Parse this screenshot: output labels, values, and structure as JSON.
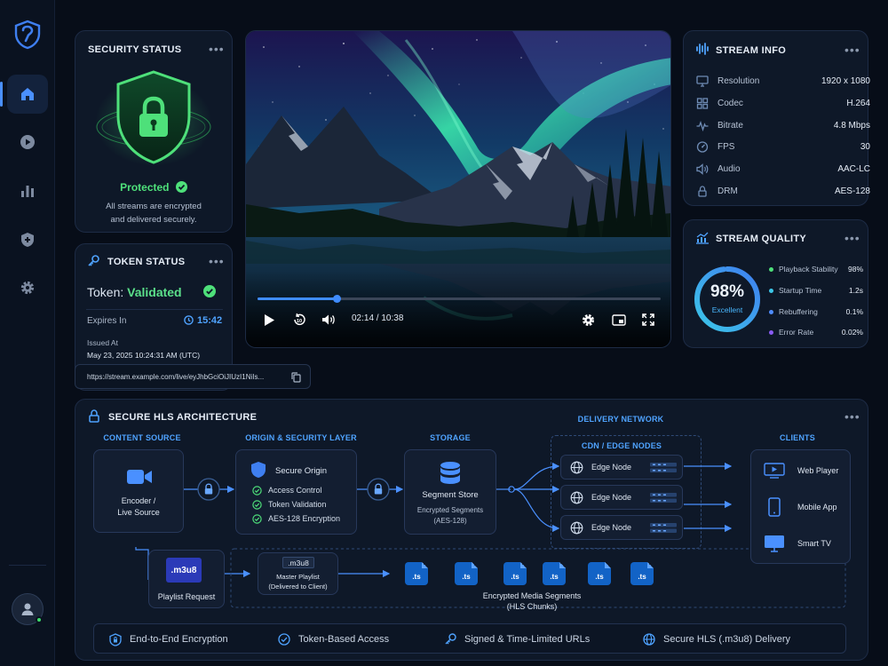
{
  "sidebar": {
    "items": [
      {
        "name": "home",
        "icon": "home-icon",
        "active": true
      },
      {
        "name": "streams",
        "icon": "play-icon",
        "active": false
      },
      {
        "name": "analytics",
        "icon": "bar-chart-icon",
        "active": false
      },
      {
        "name": "security",
        "icon": "shield-plus-icon",
        "active": false
      },
      {
        "name": "settings",
        "icon": "gear-icon",
        "active": false
      }
    ]
  },
  "security": {
    "title": "SECURITY STATUS",
    "status": "Protected",
    "description_line1": "All streams are encrypted",
    "description_line2": "and delivered securely."
  },
  "token": {
    "title": "TOKEN STATUS",
    "prefix": "Token:",
    "value": "Validated",
    "expires_label": "Expires In",
    "expires_value": "15:42",
    "issued_label": "Issued At",
    "issued_value": "May 23, 2025 10:24:31 AM (UTC)",
    "url": "https://stream.example.com/live/eyJhbGciOiJIUzI1NiIs..."
  },
  "player": {
    "current_time": "02:14",
    "duration": "10:38",
    "time_display": "02:14 / 10:38",
    "progress": 0.195
  },
  "stream_info": {
    "title": "STREAM INFO",
    "rows": [
      {
        "label": "Resolution",
        "value": "1920 x 1080",
        "icon": "monitor-icon"
      },
      {
        "label": "Codec",
        "value": "H.264",
        "icon": "grid-icon"
      },
      {
        "label": "Bitrate",
        "value": "4.8 Mbps",
        "icon": "pulse-icon"
      },
      {
        "label": "FPS",
        "value": "30",
        "icon": "speedometer-icon"
      },
      {
        "label": "Audio",
        "value": "AAC-LC",
        "icon": "speaker-icon"
      },
      {
        "label": "DRM",
        "value": "AES-128",
        "icon": "lock-icon"
      }
    ]
  },
  "quality": {
    "title": "STREAM QUALITY",
    "score": "98%",
    "score_value": 0.98,
    "score_label": "Excellent",
    "rows": [
      {
        "label": "Playback Stability",
        "value": "98%",
        "color": "#4ee07a"
      },
      {
        "label": "Startup Time",
        "value": "1.2s",
        "color": "#3cc6e8"
      },
      {
        "label": "Rebuffering",
        "value": "0.1%",
        "color": "#4f8cff"
      },
      {
        "label": "Error Rate",
        "value": "0.02%",
        "color": "#8a5cf6"
      }
    ]
  },
  "architecture": {
    "title": "SECURE HLS ARCHITECTURE",
    "delivery_network": "DELIVERY NETWORK",
    "sections": {
      "content_source": "CONTENT SOURCE",
      "origin": "ORIGIN & SECURITY LAYER",
      "storage": "STORAGE",
      "cdn": "CDN / EDGE NODES",
      "clients": "CLIENTS"
    },
    "encoder": {
      "line1": "Encoder /",
      "line2": "Live Source"
    },
    "origin_node": {
      "title": "Secure Origin",
      "items": [
        "Access Control",
        "Token Validation",
        "AES-128 Encryption"
      ]
    },
    "storage_node": {
      "title": "Segment Store",
      "line1": "Encrypted Segments",
      "line2": "(AES-128)"
    },
    "edges": [
      "Edge Node",
      "Edge Node",
      "Edge Node"
    ],
    "clients": [
      "Web Player",
      "Mobile App",
      "Smart TV"
    ],
    "playlist_request": {
      "badge": ".m3u8",
      "label": "Playlist Request"
    },
    "master_playlist": {
      "badge": ".m3u8",
      "line1": "Master Playlist",
      "line2": "(Delivered to Client)"
    },
    "segment_badge": ".ts",
    "segments_label_line1": "Encrypted Media Segments",
    "segments_label_line2": "(HLS Chunks)",
    "features": [
      "End-to-End Encryption",
      "Token-Based Access",
      "Signed & Time-Limited URLs",
      "Secure HLS (.m3u8) Delivery"
    ]
  },
  "colors": {
    "accent": "#4a90ff",
    "success": "#4ee07a",
    "background": "#070d18",
    "card": "#0e1828"
  }
}
